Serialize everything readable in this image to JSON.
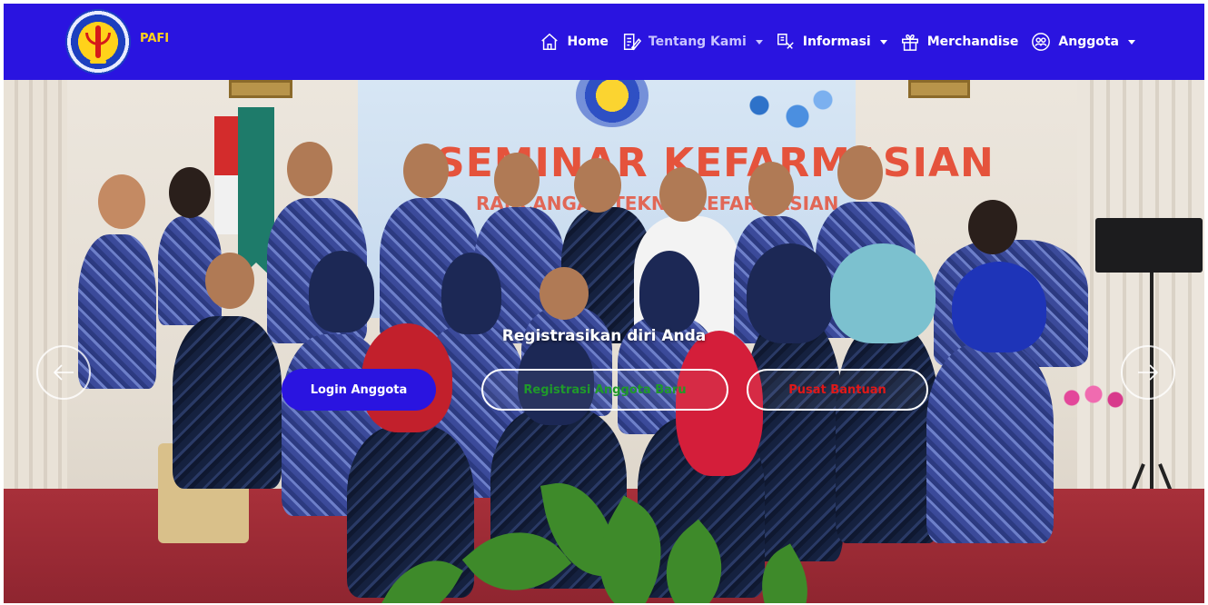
{
  "brand": {
    "name": "PAFI",
    "logo": "pafi-logo"
  },
  "nav": {
    "items": [
      {
        "label": "Home",
        "icon": "home-icon"
      },
      {
        "label": "Tentang Kami",
        "icon": "document-edit-icon",
        "dropdown": true
      },
      {
        "label": "Informasi",
        "icon": "info-board-icon",
        "dropdown": true
      },
      {
        "label": "Merchandise",
        "icon": "gift-icon"
      },
      {
        "label": "Anggota",
        "icon": "members-icon",
        "dropdown": true
      }
    ]
  },
  "hero": {
    "banner_title": "SEMINAR KEFARMASIAN",
    "banner_subtitle": "RANCANGAN TEKNIS KEFARMASIAN",
    "title": "Registrasikan diri Anda",
    "buttons": {
      "login": "Login Anggota",
      "register": "Registrasi Anggota Baru",
      "help": "Pusat Bantuan"
    },
    "prev_icon": "arrow-left-icon",
    "next_icon": "arrow-right-icon"
  },
  "colors": {
    "navbar": "#2a14e0",
    "brand_text": "#ffd21a",
    "register_text": "#1f9a2a",
    "help_text": "#e01818",
    "floor": "#a8303a"
  }
}
